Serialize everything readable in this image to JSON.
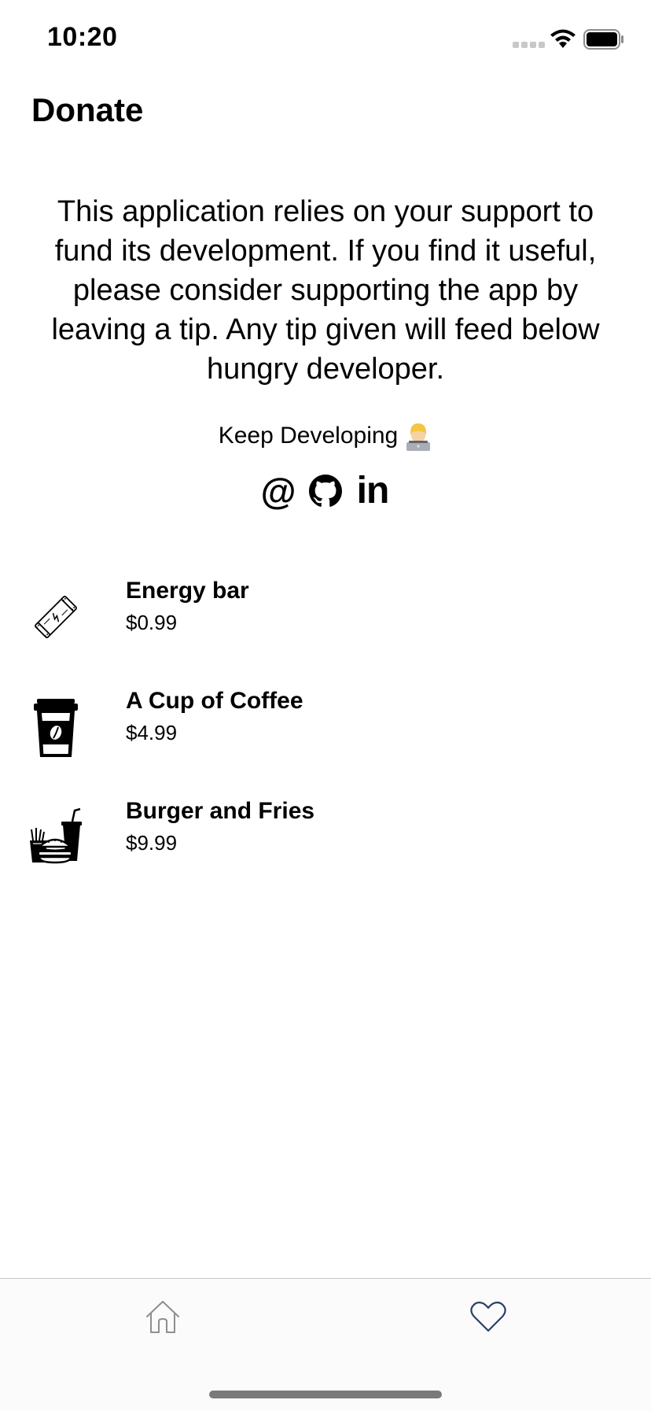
{
  "status_bar": {
    "time": "10:20",
    "icons": [
      "signal-icon",
      "wifi-icon",
      "battery-icon"
    ]
  },
  "header": {
    "title": "Donate"
  },
  "intro": {
    "text": "This application relies on your support to fund its development. If you find it useful, please consider supporting the app by leaving a tip. Any tip given will feed below hungry developer.",
    "keep_developing": "Keep Developing",
    "emoji_icon": "technologist-emoji-icon"
  },
  "social": {
    "email_glyph": "@",
    "linkedin_glyph": "in",
    "icons": [
      "at-icon",
      "github-icon",
      "linkedin-icon"
    ]
  },
  "tips": [
    {
      "name": "Energy bar",
      "price": "$0.99",
      "icon": "energy-bar-icon"
    },
    {
      "name": "A Cup of Coffee",
      "price": "$4.99",
      "icon": "coffee-cup-icon"
    },
    {
      "name": "Burger and Fries",
      "price": "$9.99",
      "icon": "burger-fries-icon"
    }
  ],
  "tab_bar": {
    "tabs": [
      {
        "icon": "home-icon",
        "selected": false
      },
      {
        "icon": "heart-icon",
        "selected": true
      }
    ],
    "inactive_color": "#8e8e93",
    "active_color": "#2c3e6b"
  }
}
